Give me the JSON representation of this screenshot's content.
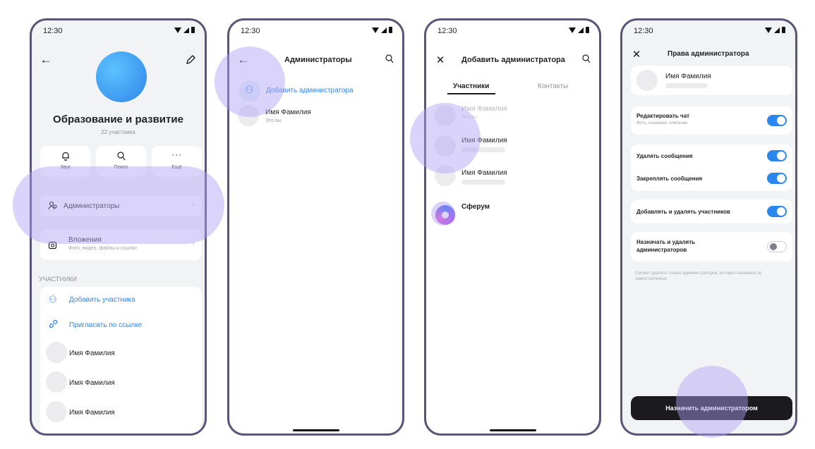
{
  "status_time": "12:30",
  "screen1": {
    "group_title": "Образование и развитие",
    "members_count": "22 участника",
    "actions": [
      {
        "icon": "bell-icon",
        "label": "Звук"
      },
      {
        "icon": "search-icon",
        "label": "Поиск"
      },
      {
        "icon": "more-icon",
        "label": "Ещё"
      }
    ],
    "admins_label": "Администраторы",
    "attachments_label": "Вложения",
    "attachments_sub": "Фото, видео, файлы и ссылки",
    "section_members": "УЧАСТНИКИ",
    "add_member": "Добавить участника",
    "invite_link": "Пригласить по ссылке",
    "members": [
      "Имя Фамилия",
      "Имя Фамилия",
      "Имя Фамилия"
    ]
  },
  "screen2": {
    "title": "Администраторы",
    "add_admin": "Добавить администратора",
    "admin_name": "Имя Фамилия",
    "admin_sub": "Это вы"
  },
  "screen3": {
    "title": "Добавить администратора",
    "tab_members": "Участники",
    "tab_contacts": "Контакты",
    "rows": [
      {
        "name": "Имя Фамилия",
        "sub": "Это вы"
      },
      {
        "name": "Имя Фамилия",
        "sub": ""
      },
      {
        "name": "Имя Фамилия",
        "sub": ""
      }
    ],
    "sferum": "Сферум"
  },
  "screen4": {
    "title": "Права администратора",
    "user_name": "Имя Фамилия",
    "edit_chat": "Редактировать чат",
    "edit_chat_sub": "Фото, название, описание",
    "delete_messages": "Удалять сообщения",
    "pin_messages": "Закреплять сообщения",
    "manage_members": "Добавлять и удалять участников",
    "manage_admins": "Назначать и удалять администраторов",
    "hint": "Сможет удалять только администраторов, которых назначил(-а) самостоятельно",
    "assign_button": "Назначить администратором",
    "toggles": {
      "edit_chat": true,
      "delete_messages": true,
      "pin_messages": true,
      "manage_members": true,
      "manage_admins": false
    }
  },
  "colors": {
    "accent": "#2f86e8",
    "frame": "#5b5577",
    "highlight": "#afa0f5",
    "button_dark": "#1a1a1f"
  }
}
